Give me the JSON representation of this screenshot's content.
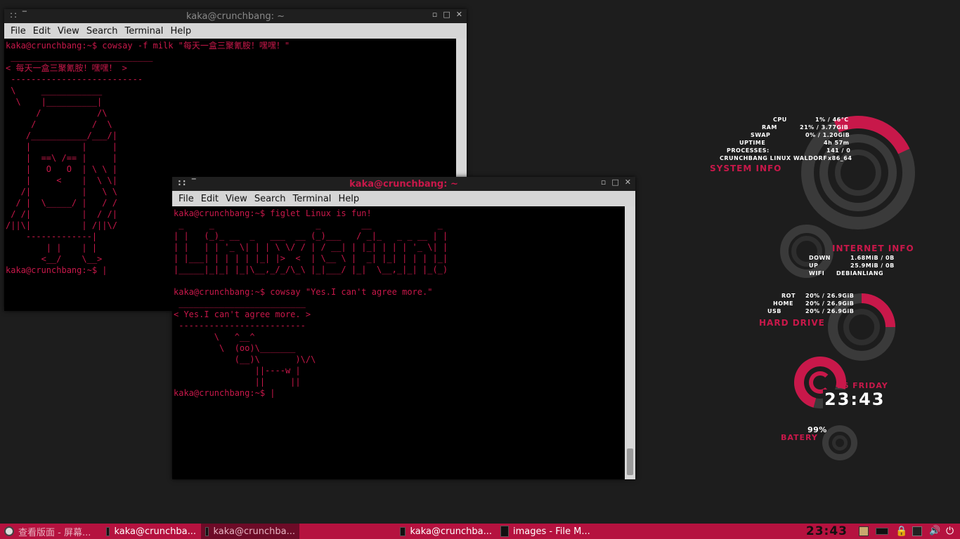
{
  "windows": [
    {
      "title": "kaka@crunchbang: ~",
      "menu": [
        "File",
        "Edit",
        "View",
        "Search",
        "Terminal",
        "Help"
      ],
      "content": "kaka@crunchbang:~$ cowsay -f milk \"每天一盒三聚氰胺！嘿嘿！\"\n ____________________________\n< 每天一盒三聚氰胺！嘿嘿！ >\n --------------------------\n \\     ____________\n  \\    |__________|\n      /           /\\\n     /           /  \\\n    /___________/___/|\n    |          |     |\n    |  ==\\ /== |     |\n    |   O   O  | \\ \\ |\n    |     <    |  \\ \\|\n   /|          |   \\ \\\n  / |  \\_____/ |   / /\n / /|          |  / /|\n/||\\|          | /||\\/\n    -------------|\n        | |    | |\n       <__/    \\__>\nkaka@crunchbang:~$ |"
    },
    {
      "title": "kaka@crunchbang: ~",
      "menu": [
        "File",
        "Edit",
        "View",
        "Search",
        "Terminal",
        "Help"
      ],
      "content": "kaka@crunchbang:~$ figlet Linux is fun!\n _     _                    _        __             _ \n| |   (_)_ __  _   ___  __ (_)___   / _|_   _ _ __ | |\n| |   | | '_ \\| | | \\ \\/ / | / __| | |_| | | | '_ \\| |\n| |___| | | | | |_| |>  <  | \\__ \\ |  _| |_| | | | |_|\n|_____|_|_| |_|\\__,_/_/\\_\\ |_|___/ |_|  \\__,_|_| |_(_)\n\nkaka@crunchbang:~$ cowsay \"Yes.I can't agree more.\"\n _________________________\n< Yes.I can't agree more. >\n -------------------------\n        \\   ^__^\n         \\  (oo)\\_______\n            (__)\\       )\\/\\\n                ||----w |\n                ||     ||\nkaka@crunchbang:~$ |"
    }
  ],
  "conky": {
    "system": {
      "title": "SYSTEM INFO",
      "rows": [
        {
          "label": "CPU",
          "value": "1% / 46°C"
        },
        {
          "label": "RAM",
          "value": "21% / 3.77GiB"
        },
        {
          "label": "SWAP",
          "value": "0% / 1.20GiB"
        },
        {
          "label": "UPTIME",
          "value": "4h 57m"
        },
        {
          "label": "PROCESSES:",
          "value": "141 / 0"
        },
        {
          "label": "CRUNCHBANG LINUX WALDORF",
          "value": "x86_64"
        }
      ]
    },
    "internet": {
      "title": "INTERNET INFO",
      "rows": [
        {
          "label": "DOWN",
          "value": "1.68MiB / 0B"
        },
        {
          "label": "UP",
          "value": "25.9MiB / 0B"
        },
        {
          "label": "WIFI",
          "value": "DEBIANLIANG"
        }
      ]
    },
    "drive": {
      "title": "HARD DRIVE",
      "rows": [
        {
          "label": "ROT",
          "value": "20% / 26.9GiB"
        },
        {
          "label": "HOME",
          "value": "20% / 26.9GiB"
        },
        {
          "label": "USB",
          "value": "20% / 26.9GiB"
        }
      ]
    },
    "clock": {
      "date": "26 FRIDAY",
      "time": "23:43"
    },
    "battery": {
      "percent": "99%",
      "label": "BATERY"
    }
  },
  "taskbar": {
    "tasks": [
      {
        "label": "查看版面 - 屏幕...",
        "active": false
      },
      {
        "label": "kaka@crunchba...",
        "active": false
      },
      {
        "label": "kaka@crunchba...",
        "active": true
      },
      {
        "label": "kaka@crunchba...",
        "active": false
      },
      {
        "label": "images - File M...",
        "active": false
      }
    ],
    "clock": "23:43"
  },
  "colors": {
    "accent": "#c8184a",
    "panel": "#b5123f",
    "bg": "#1d1d1d"
  }
}
